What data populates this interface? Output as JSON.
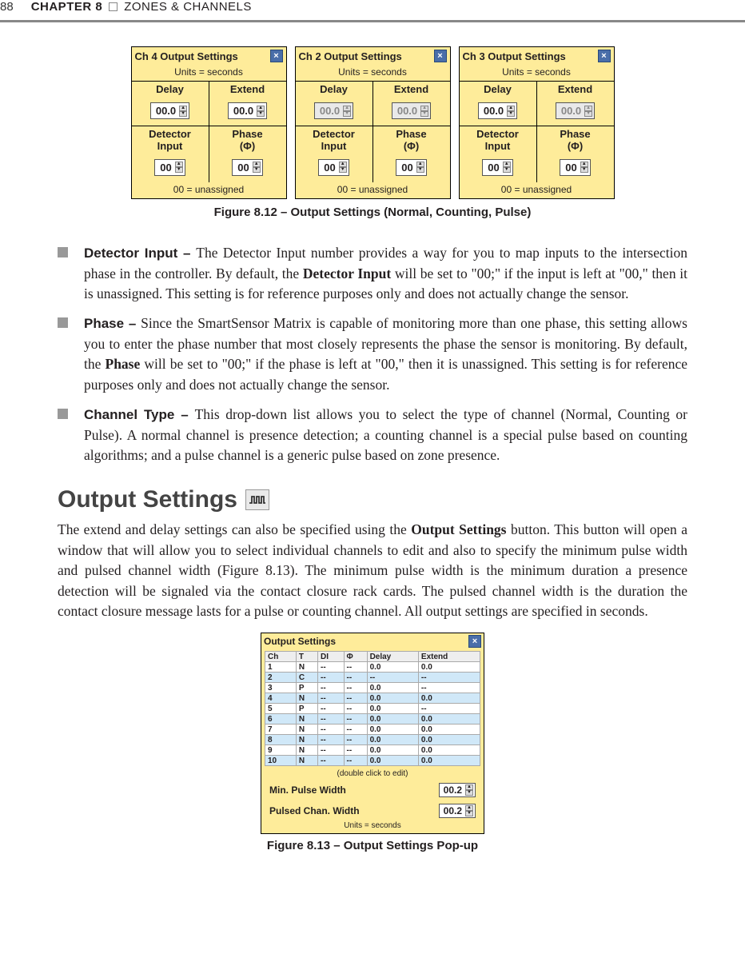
{
  "header": {
    "page": "88",
    "chapter": "CHAPTER 8",
    "section": "ZONES & CHANNELS"
  },
  "fig1": {
    "caption": "Figure 8.12 – Output Settings (Normal, Counting, Pulse)",
    "boxes": [
      {
        "title": "Ch 4 Output Settings",
        "units": "Units = seconds",
        "delay_label": "Delay",
        "extend_label": "Extend",
        "delay_val": "00.0",
        "extend_val": "00.0",
        "delay_disabled": false,
        "extend_disabled": false,
        "det_label": "Detector Input",
        "phase_label": "Phase (Φ)",
        "det_val": "00",
        "phase_val": "00",
        "foot": "00 = unassigned"
      },
      {
        "title": "Ch 2 Output Settings",
        "units": "Units = seconds",
        "delay_label": "Delay",
        "extend_label": "Extend",
        "delay_val": "00.0",
        "extend_val": "00.0",
        "delay_disabled": true,
        "extend_disabled": true,
        "det_label": "Detector Input",
        "phase_label": "Phase (Φ)",
        "det_val": "00",
        "phase_val": "00",
        "foot": "00 = unassigned"
      },
      {
        "title": "Ch 3 Output Settings",
        "units": "Units = seconds",
        "delay_label": "Delay",
        "extend_label": "Extend",
        "delay_val": "00.0",
        "extend_val": "00.0",
        "delay_disabled": false,
        "extend_disabled": true,
        "det_label": "Detector Input",
        "phase_label": "Phase (Φ)",
        "det_val": "00",
        "phase_val": "00",
        "foot": "00 = unassigned"
      }
    ]
  },
  "bullets": [
    {
      "term": "Detector Input – ",
      "text_a": "The Detector Input number provides a way for you to map inputs to the intersection phase in the controller. By default, the ",
      "bold_a": "Detector Input",
      "text_b": " will be set to \"00;\" if the input is left at \"00,\" then it is unassigned. This setting is for reference purposes only and does not actually change the sensor."
    },
    {
      "term": "Phase – ",
      "text_a": "Since the SmartSensor Matrix is capable of monitoring more than one phase, this setting allows you to enter the phase number that most closely represents the phase the sensor is monitoring. By default, the ",
      "bold_a": "Phase",
      "text_b": " will be set to \"00;\" if the phase is left at \"00,\" then it is unassigned. This setting is for reference purposes only and does not actually change the sensor."
    },
    {
      "term": "Channel Type – ",
      "text_a": "This drop-down list allows you to select the type of channel (Normal, Counting or Pulse). A normal channel is presence detection; a counting channel is a special pulse based on counting algorithms; and a pulse channel is a generic pulse based on zone presence.",
      "bold_a": "",
      "text_b": ""
    }
  ],
  "section_heading": "Output Settings",
  "body_para": {
    "a": "The extend and delay settings can also be specified using the ",
    "b": "Output Settings",
    "c": " button. This button will open a window that will allow you to select individual channels to edit and also to specify the minimum pulse width and pulsed channel width (Figure 8.13). The minimum pulse width is the minimum duration a presence detection will be signaled via the contact closure rack cards. The pulsed channel width is the duration the contact closure message lasts for a pulse or counting channel. All output settings are specified in seconds."
  },
  "fig2": {
    "caption": "Figure 8.13 – Output Settings Pop-up",
    "title": "Output Settings",
    "headers": [
      "Ch",
      "T",
      "DI",
      "Φ",
      "Delay",
      "Extend"
    ],
    "rows": [
      [
        "1",
        "N",
        "--",
        "--",
        "0.0",
        "0.0"
      ],
      [
        "2",
        "C",
        "--",
        "--",
        "--",
        "--"
      ],
      [
        "3",
        "P",
        "--",
        "--",
        "0.0",
        "--"
      ],
      [
        "4",
        "N",
        "--",
        "--",
        "0.0",
        "0.0"
      ],
      [
        "5",
        "P",
        "--",
        "--",
        "0.0",
        "--"
      ],
      [
        "6",
        "N",
        "--",
        "--",
        "0.0",
        "0.0"
      ],
      [
        "7",
        "N",
        "--",
        "--",
        "0.0",
        "0.0"
      ],
      [
        "8",
        "N",
        "--",
        "--",
        "0.0",
        "0.0"
      ],
      [
        "9",
        "N",
        "--",
        "--",
        "0.0",
        "0.0"
      ],
      [
        "10",
        "N",
        "--",
        "--",
        "0.0",
        "0.0"
      ]
    ],
    "note": "(double click to edit)",
    "min_label": "Min. Pulse Width",
    "min_val": "00.2",
    "pulsed_label": "Pulsed Chan. Width",
    "pulsed_val": "00.2",
    "units": "Units = seconds"
  }
}
